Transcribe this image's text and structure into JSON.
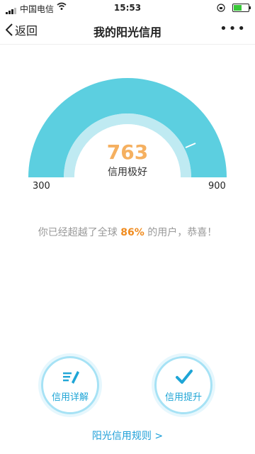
{
  "status_bar": {
    "carrier": "中国电信",
    "time": "15:53"
  },
  "nav": {
    "back_label": "返回",
    "title": "我的阳光信用",
    "more_label": "•••"
  },
  "gauge": {
    "score": "763",
    "level": "信用极好",
    "min": "300",
    "max": "900",
    "colors": {
      "outer": "#5ccfe0",
      "inner": "#bfeaf2",
      "score": "#f5b060"
    }
  },
  "rank": {
    "prefix": "你已经超越了全球",
    "percent": "86%",
    "suffix": "的用户，恭喜！"
  },
  "actions": [
    {
      "label": "信用详解",
      "icon": "pen-icon"
    },
    {
      "label": "信用提升",
      "icon": "check-icon"
    }
  ],
  "rules_link": "阳光信用规则 >"
}
